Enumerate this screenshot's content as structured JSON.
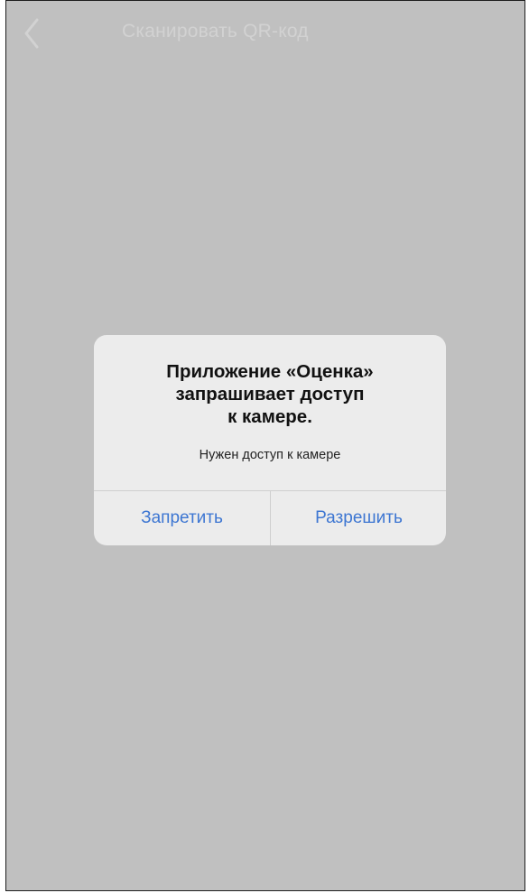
{
  "navbar": {
    "back_icon": "chevron-left-icon",
    "title": "Сканировать QR-код"
  },
  "alert": {
    "title_lines": [
      "Приложение «Оценка»",
      "запрашивает доступ",
      "к камере."
    ],
    "message": "Нужен доступ к камере",
    "deny_label": "Запретить",
    "allow_label": "Разрешить"
  },
  "colors": {
    "background": "#c0c0c0",
    "alert_background": "#ececec",
    "button_text": "#3d76d2"
  }
}
